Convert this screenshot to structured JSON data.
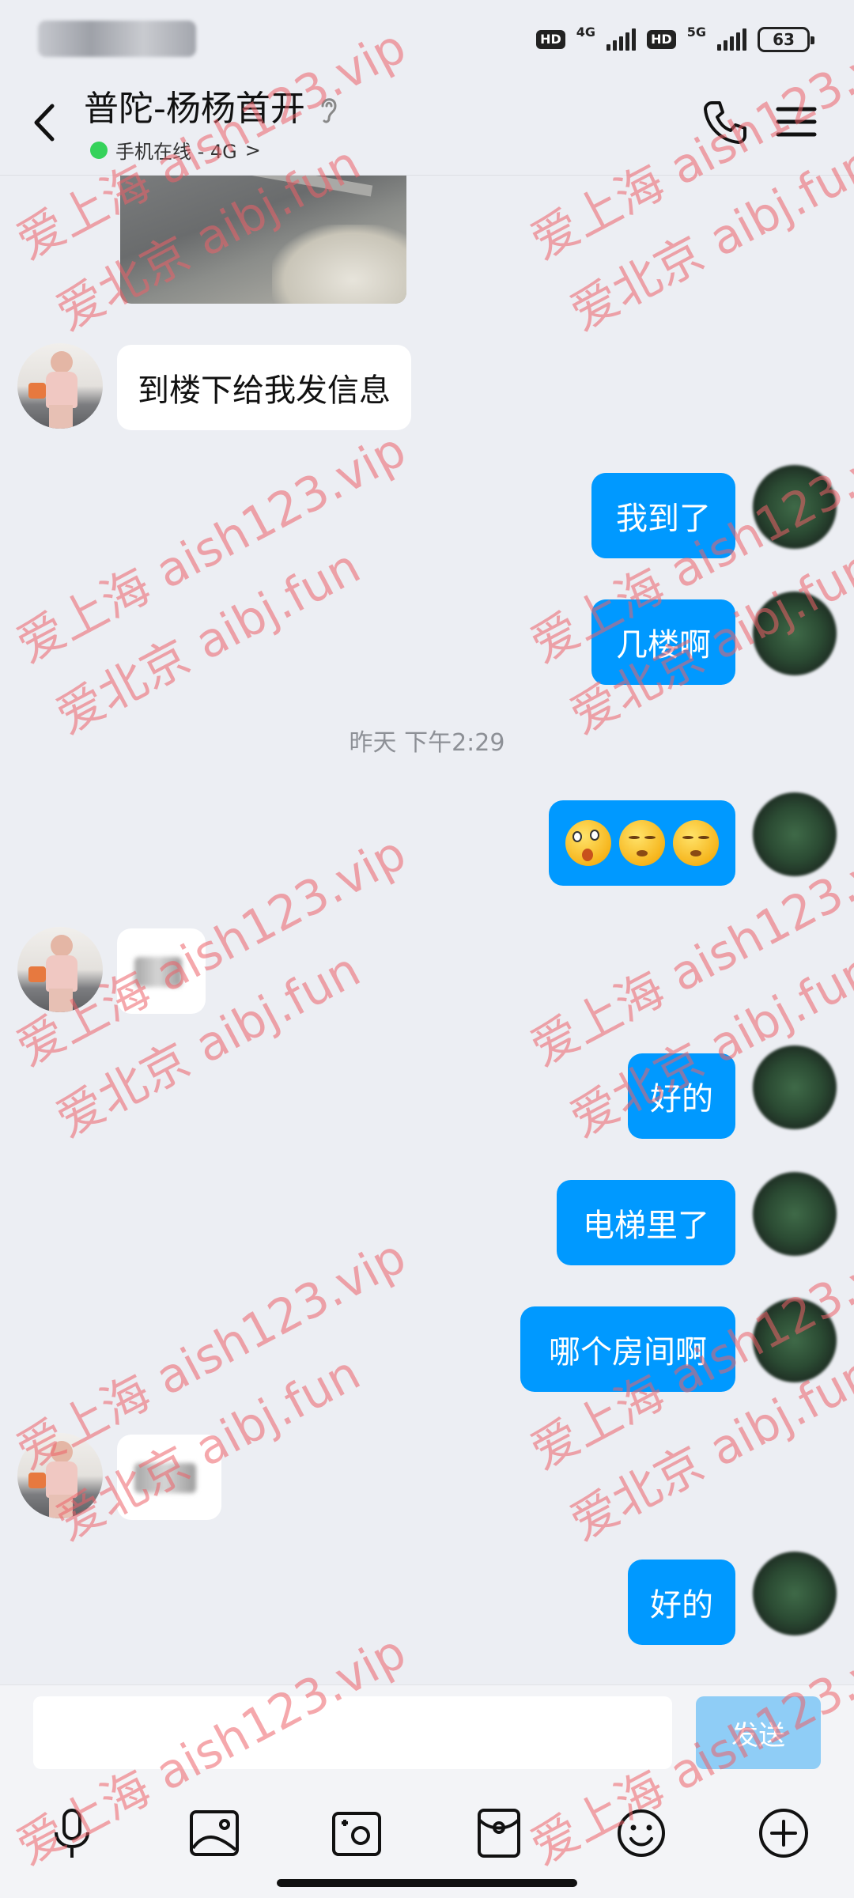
{
  "status_bar": {
    "left_blurred": "",
    "hd1": "HD",
    "net1": "4G",
    "hd2": "HD",
    "net2": "5G",
    "battery": "63"
  },
  "header": {
    "title": "普陀-杨杨首开",
    "status": "手机在线 - 4G",
    "status_chevron": ">"
  },
  "chat": {
    "msg1": "到楼下给我发信息",
    "msg2": "我到了",
    "msg3": "几楼啊",
    "timestamp": "昨天 下午2:29",
    "msg5": "好的",
    "msg6": "电梯里了",
    "msg7": "哪个房间啊",
    "msg8": "好的"
  },
  "input": {
    "placeholder": "",
    "send_label": "发送"
  },
  "watermark": {
    "line_a": "爱上海 aish123.vip",
    "line_b": "爱北京 aibj.fun"
  },
  "colors": {
    "accent": "#0099ff",
    "online": "#35d25a",
    "background": "#eceef3",
    "watermark": "#ec6068"
  }
}
